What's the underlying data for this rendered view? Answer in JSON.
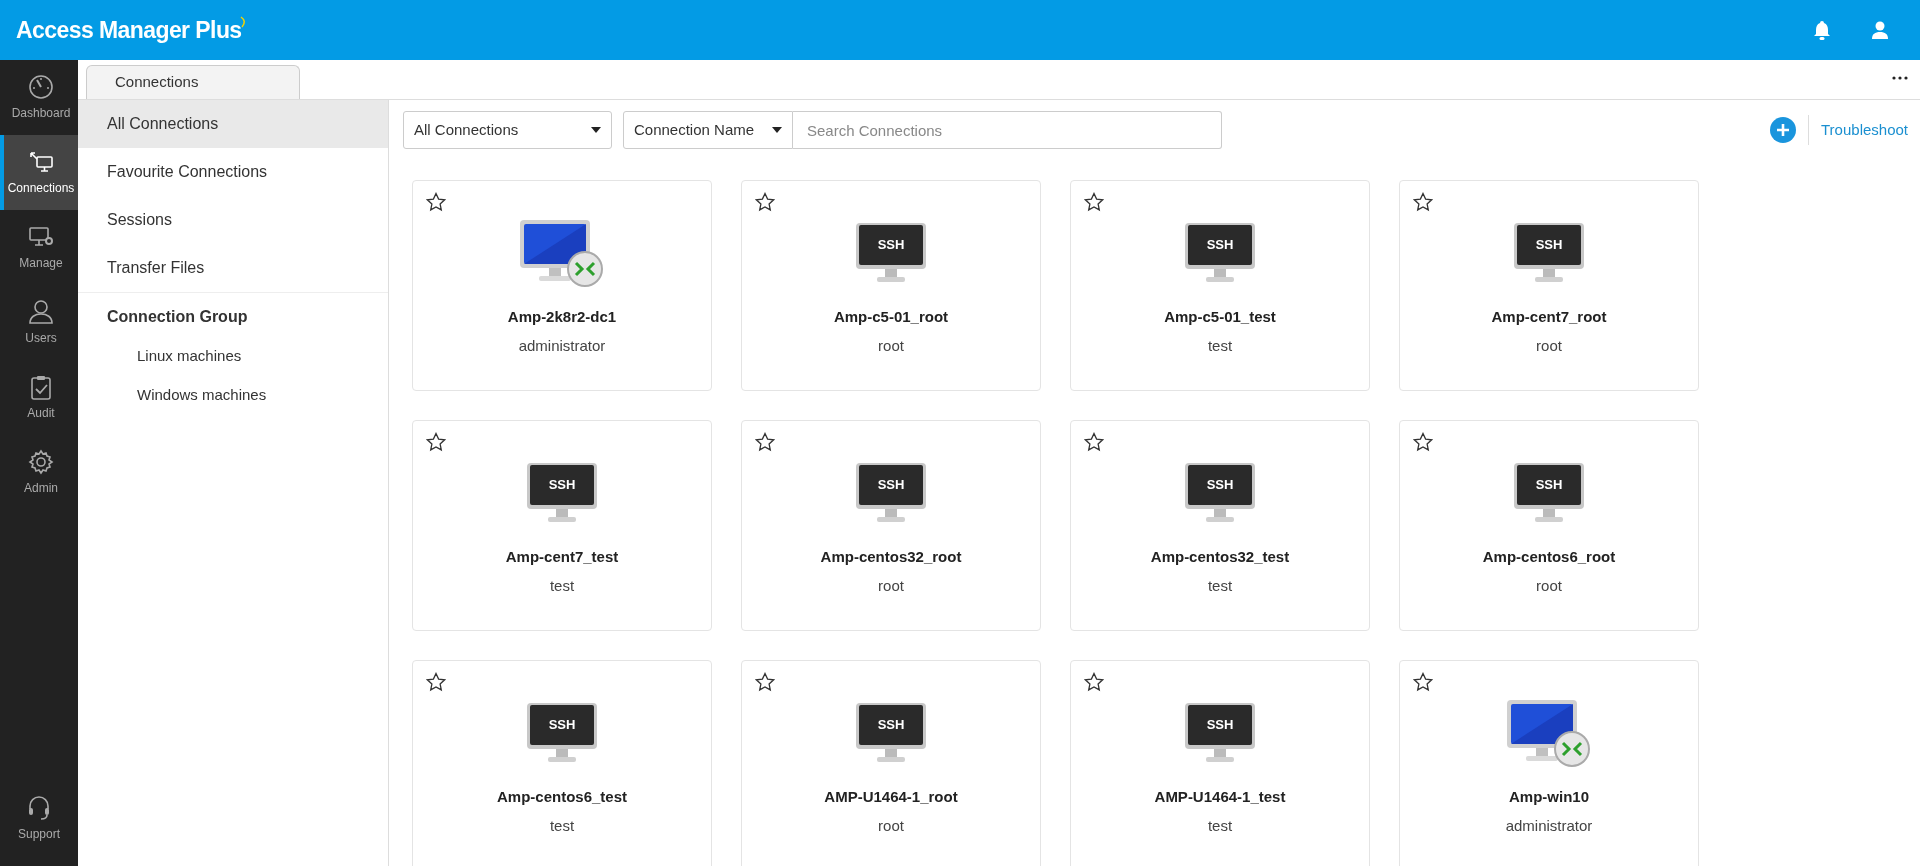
{
  "header": {
    "brand": "Access Manager Plus"
  },
  "nav_rail": [
    {
      "label": "Dashboard",
      "selected": false
    },
    {
      "label": "Connections",
      "selected": true
    },
    {
      "label": "Manage",
      "selected": false
    },
    {
      "label": "Users",
      "selected": false
    },
    {
      "label": "Audit",
      "selected": false
    },
    {
      "label": "Admin",
      "selected": false
    }
  ],
  "nav_rail_bottom": {
    "label": "Support"
  },
  "tabs": [
    {
      "label": "Connections",
      "selected": true
    }
  ],
  "sidebar": {
    "items": [
      {
        "label": "All Connections",
        "selected": true
      },
      {
        "label": "Favourite Connections",
        "selected": false
      },
      {
        "label": "Sessions",
        "selected": false
      },
      {
        "label": "Transfer Files",
        "selected": false
      }
    ],
    "group": {
      "label": "Connection Group",
      "children": [
        {
          "label": "Linux machines"
        },
        {
          "label": "Windows machines"
        }
      ]
    }
  },
  "toolbar": {
    "filter": "All Connections",
    "search_by": "Connection Name",
    "search": {
      "placeholder": "Search Connections"
    },
    "troubleshoot": "Troubleshoot"
  },
  "connections": [
    {
      "kind": "rdp",
      "name": "Amp-2k8r2-dc1",
      "user": "administrator",
      "favourite": false
    },
    {
      "kind": "ssh",
      "screen_label": "SSH",
      "name": "Amp-c5-01_root",
      "user": "root",
      "favourite": false
    },
    {
      "kind": "ssh",
      "screen_label": "SSH",
      "name": "Amp-c5-01_test",
      "user": "test",
      "favourite": false
    },
    {
      "kind": "ssh",
      "screen_label": "SSH",
      "name": "Amp-cent7_root",
      "user": "root",
      "favourite": false
    },
    {
      "kind": "ssh",
      "screen_label": "SSH",
      "name": "Amp-cent7_test",
      "user": "test",
      "favourite": false
    },
    {
      "kind": "ssh",
      "screen_label": "SSH",
      "name": "Amp-centos32_root",
      "user": "root",
      "favourite": false
    },
    {
      "kind": "ssh",
      "screen_label": "SSH",
      "name": "Amp-centos32_test",
      "user": "test",
      "favourite": false
    },
    {
      "kind": "ssh",
      "screen_label": "SSH",
      "name": "Amp-centos6_root",
      "user": "root",
      "favourite": false
    },
    {
      "kind": "ssh",
      "screen_label": "SSH",
      "name": "Amp-centos6_test",
      "user": "test",
      "favourite": false
    },
    {
      "kind": "ssh",
      "screen_label": "SSH",
      "name": "AMP-U1464-1_root",
      "user": "root",
      "favourite": false
    },
    {
      "kind": "ssh",
      "screen_label": "SSH",
      "name": "AMP-U1464-1_test",
      "user": "test",
      "favourite": false
    },
    {
      "kind": "rdp",
      "name": "Amp-win10",
      "user": "administrator",
      "favourite": false
    }
  ]
}
